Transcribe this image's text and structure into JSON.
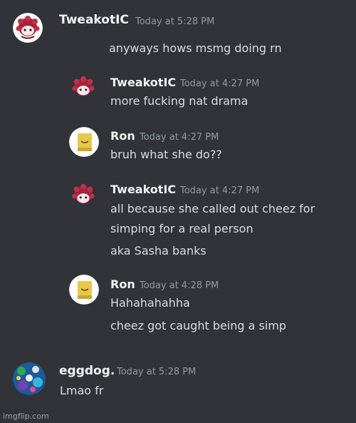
{
  "outer_messages": [
    {
      "author": "TweakotIC",
      "time": "Today at 5:28 PM",
      "text": "anyways hows msmg doing rn",
      "avatar_icon": "tweakotic-avatar-icon"
    },
    {
      "author": "eggdog.",
      "time": "Today at 5:28 PM",
      "text": "Lmao fr",
      "avatar_icon": "eggdog-avatar-icon"
    }
  ],
  "quoted_messages": [
    {
      "author": "TweakotIC",
      "time": "Today at 4:27 PM",
      "lines": [
        "more fucking nat drama"
      ],
      "avatar_icon": "tweakotic-avatar-icon"
    },
    {
      "author": "Ron",
      "time": "Today at 4:27 PM",
      "lines": [
        "bruh what she do??"
      ],
      "avatar_icon": "ron-avatar-icon"
    },
    {
      "author": "TweakotIC",
      "time": "Today at 4:27 PM",
      "lines": [
        "all because she called out cheez for",
        "simping for a real person",
        "aka Sasha banks"
      ],
      "avatar_icon": "tweakotic-avatar-icon"
    },
    {
      "author": "Ron",
      "time": "Today at 4:28 PM",
      "lines": [
        "Hahahahahha",
        "cheez got caught being a simp"
      ],
      "avatar_icon": "ron-avatar-icon"
    }
  ],
  "watermark": "imgflip.com",
  "colors": {
    "background": "#313338",
    "name": "#f2f3f5",
    "timestamp": "#949ba4",
    "text": "#dbdee1"
  }
}
